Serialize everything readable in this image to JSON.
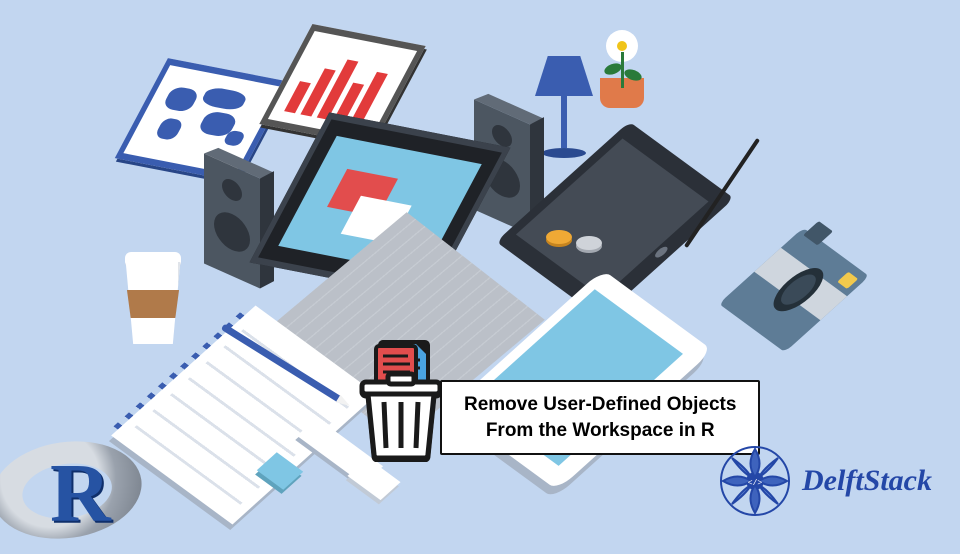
{
  "caption": {
    "line1": "Remove User-Defined Objects",
    "line2": "From the Workspace in R"
  },
  "icons": {
    "trash": "trash-document-icon",
    "r_logo_letter": "R",
    "map": "world-map-icon",
    "chart": "bar-chart-icon",
    "lamp": "lamp-icon",
    "plant": "flower-pot-icon",
    "speaker": "speaker-icon",
    "laptop": "laptop-icon",
    "tablet_dark": "drawing-tablet-icon",
    "stylus": "stylus-icon",
    "coin_gold": "gold-coin-icon",
    "coin_silver": "silver-coin-icon",
    "camera": "camera-icon",
    "tablet_white": "tablet-icon",
    "cup": "coffee-cup-icon",
    "notepad": "notepad-icon",
    "pen": "pen-icon",
    "books": "books-icon",
    "mandala": "mandala-icon"
  },
  "brand": {
    "name": "DelftStack",
    "code_tag": "</>"
  },
  "colors": {
    "bg": "#c2d6f0",
    "accent_blue": "#3a5db0",
    "accent_red": "#e23b3b",
    "brand_blue": "#2447a7"
  }
}
